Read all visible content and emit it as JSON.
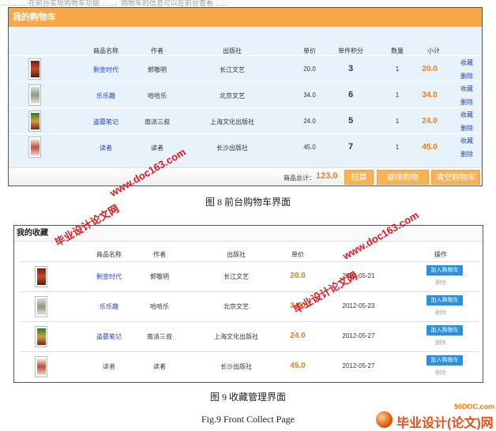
{
  "top_text": "…………在前台实现购物车功能……，购物车的信息可以在前台查看……",
  "cart": {
    "title": "我的购物车",
    "columns": [
      "商品名称",
      "作者",
      "出版社",
      "单价",
      "单件积分",
      "数量",
      "小计"
    ],
    "rows": [
      {
        "name": "剩金时代",
        "author": "郭敬明",
        "publisher": "长江文艺",
        "price": "20.0",
        "points": "3",
        "qty": "1",
        "subtotal": "20.0",
        "fav": "收藏",
        "del": "删除"
      },
      {
        "name": "乐乐趣",
        "author": "哈哈乐",
        "publisher": "北京文艺",
        "price": "34.0",
        "points": "6",
        "qty": "1",
        "subtotal": "34.0",
        "fav": "收藏",
        "del": "删除"
      },
      {
        "name": "盗墓笔记",
        "author": "南派三叔",
        "publisher": "上海文化出版社",
        "price": "24.0",
        "points": "5",
        "qty": "1",
        "subtotal": "24.0",
        "fav": "收藏",
        "del": "删除"
      },
      {
        "name": "读者",
        "author": "读者",
        "publisher": "长沙出版社",
        "price": "45.0",
        "points": "7",
        "qty": "1",
        "subtotal": "45.0",
        "fav": "收藏",
        "del": "删除"
      }
    ],
    "total_label": "商品总计：",
    "total_value": "123.0",
    "btn_checkout": "结算",
    "btn_continue": "继续购物",
    "btn_clear": "清空购物车"
  },
  "caption1": "图 8  前台购物车界面",
  "fav": {
    "title": "我的收藏",
    "columns": [
      "商品名称",
      "作者",
      "出版社",
      "单价",
      "",
      "操作"
    ],
    "rows": [
      {
        "name": "剩金时代",
        "author": "郭敬明",
        "publisher": "长江文艺",
        "price": "20.0",
        "date": "2012-05-21",
        "add": "加入购物车",
        "del": "删除"
      },
      {
        "name": "乐乐趣",
        "author": "哈哈乐",
        "publisher": "北京文艺",
        "price": "34.0",
        "date": "2012-05-23",
        "add": "加入购物车",
        "del": "删除"
      },
      {
        "name": "盗墓笔记",
        "author": "南派三叔",
        "publisher": "上海文化出版社",
        "price": "24.0",
        "date": "2012-05-27",
        "add": "加入购物车",
        "del": "删除"
      },
      {
        "name": "读者",
        "author": "读者",
        "publisher": "长沙出版社",
        "price": "45.0",
        "date": "2012-05-27",
        "add": "加入购物车",
        "del": "删除"
      }
    ]
  },
  "caption2": "图 9  收藏管理界面",
  "caption3": "Fig.9 Front Collect Page",
  "watermarks": {
    "url1": "www.doc163.com",
    "net1": "毕业设计论文网",
    "url2": "www.doc163.com",
    "net2": "毕业设计论文网",
    "url3": "www.doc163.com"
  },
  "logo": {
    "site": "56DOC.com",
    "text": "毕业设计(论文)网"
  },
  "colors": {
    "cart_header": "#f7a947",
    "cart_body": "#e7f2fb",
    "link_blue": "#2845b8",
    "price_orange": "#f37a18",
    "button_blue": "#2f8fd8",
    "watermark_red": "#e8141e"
  }
}
